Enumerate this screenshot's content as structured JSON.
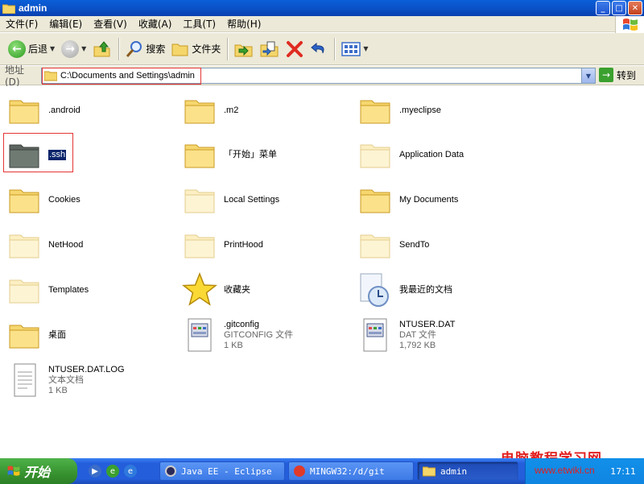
{
  "window": {
    "title": "admin",
    "controls": {
      "minimize": "_",
      "maximize": "□",
      "close": "✕"
    }
  },
  "menu": [
    "文件(F)",
    "编辑(E)",
    "查看(V)",
    "收藏(A)",
    "工具(T)",
    "帮助(H)"
  ],
  "toolbar": {
    "back_label": "后退",
    "search_label": "搜索",
    "folders_label": "文件夹"
  },
  "address": {
    "label": "地址 (D)",
    "path": "C:\\Documents and Settings\\admin",
    "go_label": "转到"
  },
  "items": [
    {
      "name": ".android",
      "icon": "folder-icon"
    },
    {
      "name": ".m2",
      "icon": "folder-icon"
    },
    {
      "name": ".myeclipse",
      "icon": "folder-icon"
    },
    {
      "name": ".ssh",
      "icon": "folder-dark-icon",
      "selected": true
    },
    {
      "name": "「开始」菜单",
      "icon": "folder-icon"
    },
    {
      "name": "Application Data",
      "icon": "folder-faded-icon"
    },
    {
      "name": "Cookies",
      "icon": "folder-icon"
    },
    {
      "name": "Local Settings",
      "icon": "folder-faded-icon"
    },
    {
      "name": "My Documents",
      "icon": "folder-icon"
    },
    {
      "name": "NetHood",
      "icon": "folder-faded-icon"
    },
    {
      "name": "PrintHood",
      "icon": "folder-faded-icon"
    },
    {
      "name": "SendTo",
      "icon": "folder-faded-icon"
    },
    {
      "name": "Templates",
      "icon": "folder-faded-icon"
    },
    {
      "name": "收藏夹",
      "icon": "star-icon"
    },
    {
      "name": "我最近的文档",
      "icon": "recent-docs-icon"
    },
    {
      "name": "桌面",
      "icon": "folder-icon"
    },
    {
      "name": ".gitconfig",
      "type": "GITCONFIG 文件",
      "size": "1 KB",
      "icon": "file-icon"
    },
    {
      "name": "NTUSER.DAT",
      "type": "DAT 文件",
      "size": "1,792 KB",
      "icon": "file-icon"
    },
    {
      "name": "NTUSER.DAT.LOG",
      "type": "文本文档",
      "size": "1 KB",
      "icon": "text-file-icon"
    }
  ],
  "taskbar": {
    "start_label": "开始",
    "tasks": [
      {
        "label": "Java EE - Eclipse"
      },
      {
        "label": "MINGW32:/d/git"
      },
      {
        "label": "admin",
        "active": true
      }
    ],
    "clock": "17:11"
  },
  "watermark": {
    "title": "电脑教程学习网",
    "url": "www.etwiki.cn"
  },
  "colors": {
    "titlebar": "#0b4fc4",
    "chrome": "#ece9d8",
    "taskbar": "#245edb",
    "start": "#37922f",
    "highlight": "#e53535"
  }
}
